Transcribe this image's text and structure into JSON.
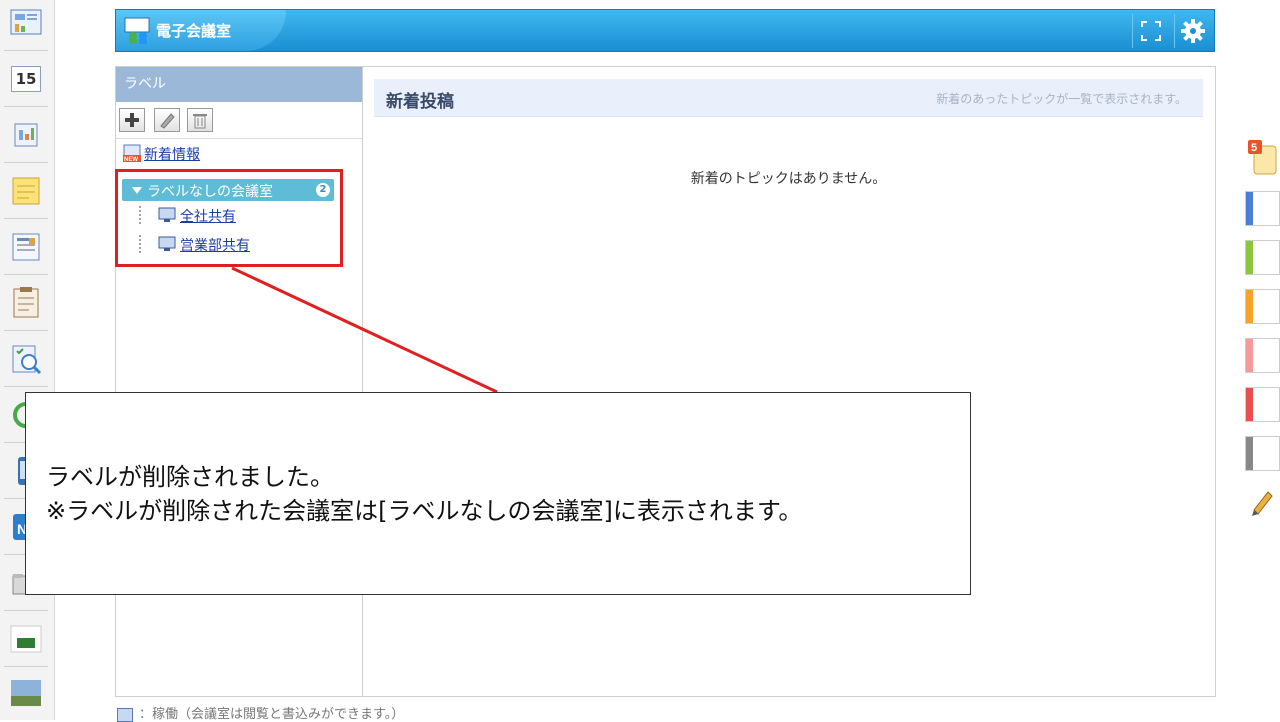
{
  "app": {
    "title": "電子会議室",
    "expand_icon": "expand-icon",
    "settings_icon": "gear-icon"
  },
  "label_panel": {
    "header": "ラベル",
    "tools": [
      "add-icon",
      "edit-icon",
      "delete-icon"
    ],
    "new_info_label": "新着情報",
    "group": {
      "label": "ラベルなしの会議室",
      "count": "2"
    },
    "rooms": [
      {
        "name": "全社共有"
      },
      {
        "name": "営業部共有"
      }
    ]
  },
  "content": {
    "title": "新着投稿",
    "description": "新着のあったトピックが一覧で表示されます。",
    "empty_message": "新着のトピックはありません。"
  },
  "footer": {
    "legend_text": "：稼働（会議室は閲覧と書込みができます。）"
  },
  "left_dock": {
    "calendar_day": "15"
  },
  "right_dock": {
    "badge_count": "5",
    "swatches": [
      "#4a7ed6",
      "#8cc63f",
      "#f7a32b",
      "#f59a9a",
      "#e84f4f",
      "#888888"
    ]
  },
  "callout": {
    "line1": "ラベルが削除されました。",
    "line2": "※ラベルが削除された会議室は[ラベルなしの会議室]に表示されます。"
  },
  "colors": {
    "accent": "#1a8fd3",
    "highlight": "#e02020"
  }
}
